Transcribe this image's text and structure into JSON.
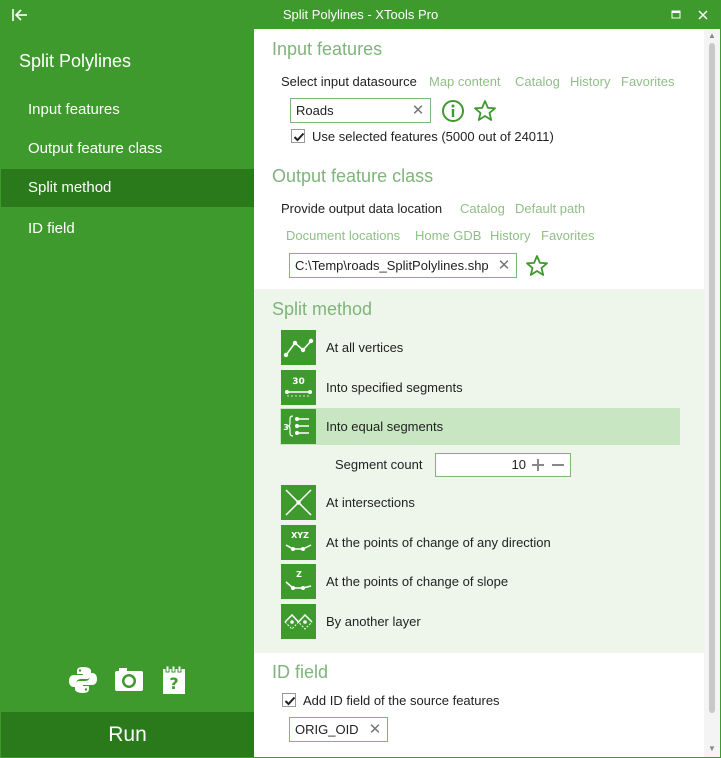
{
  "window": {
    "title": "Split Polylines - XTools Pro",
    "back_glyph": "I←",
    "accent_color": "#3f9a2e",
    "accent_dark": "#2a7a1c"
  },
  "sidebar": {
    "heading": "Split Polylines",
    "items": [
      {
        "label": "Input features",
        "active": false
      },
      {
        "label": "Output feature class",
        "active": false
      },
      {
        "label": "Split method",
        "active": true
      },
      {
        "label": "ID field",
        "active": false
      }
    ],
    "icons": [
      "python-icon",
      "camera-icon",
      "notes-icon"
    ],
    "run_label": "Run"
  },
  "input": {
    "title": "Input features",
    "datasource_label": "Select input datasource",
    "links": [
      "Map content",
      "Catalog",
      "History",
      "Favorites"
    ],
    "value": "Roads",
    "use_selected_label": "Use selected features (5000 out of 24011)",
    "use_selected_checked": true
  },
  "output": {
    "title": "Output feature class",
    "location_label": "Provide output data location",
    "links_row1": [
      "Catalog",
      "Default path"
    ],
    "links_row2": [
      "Document locations",
      "Home GDB",
      "History",
      "Favorites"
    ],
    "value": "C:\\Temp\\roads_SplitPolylines.shp"
  },
  "split": {
    "title": "Split method",
    "methods": [
      {
        "label": "At all vertices",
        "icon": "vertices-icon",
        "active": false
      },
      {
        "label": "Into specified segments",
        "icon": "specified-segments-icon",
        "icon_text": "30",
        "active": false
      },
      {
        "label": "Into equal segments",
        "icon": "equal-segments-icon",
        "icon_text": "3",
        "active": true
      },
      {
        "label": "At intersections",
        "icon": "intersections-icon",
        "active": false
      },
      {
        "label": "At the points of change of any direction",
        "icon": "direction-change-icon",
        "icon_text": "XYZ",
        "active": false
      },
      {
        "label": "At the points of change of slope",
        "icon": "slope-change-icon",
        "icon_text": "Z",
        "active": false
      },
      {
        "label": "By another layer",
        "icon": "another-layer-icon",
        "active": false
      }
    ],
    "segment_count_label": "Segment count",
    "segment_count": "10"
  },
  "id_field": {
    "title": "ID field",
    "add_label": "Add ID field of the source features",
    "add_checked": true,
    "value": "ORIG_OID"
  }
}
